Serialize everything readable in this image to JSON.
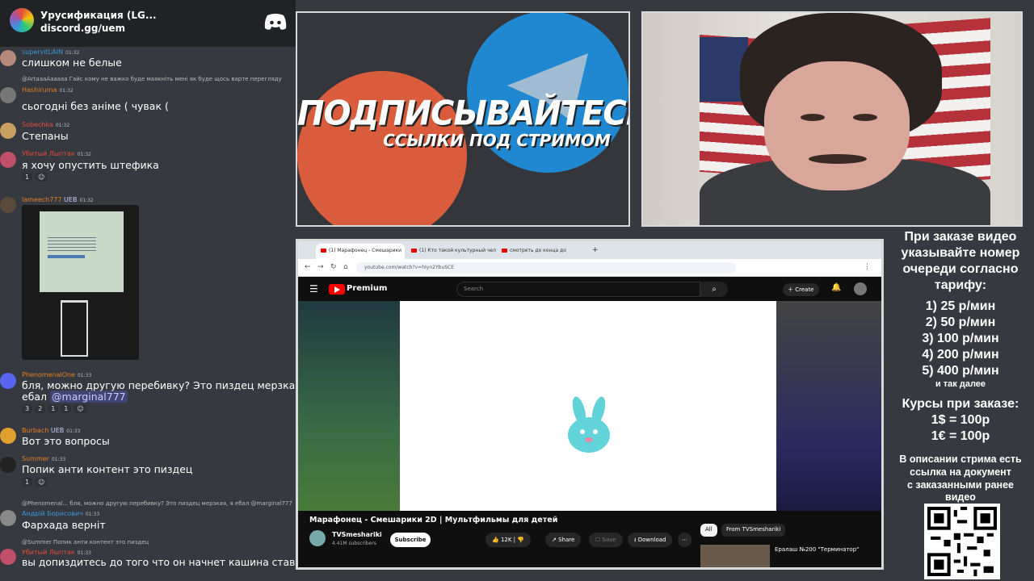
{
  "discord": {
    "server_name": "Урусификация (LG...",
    "invite": "discord.gg/uem",
    "messages": [
      {
        "user": "supervitLAIN",
        "time": "01:32",
        "text": "слишком не белые",
        "color": "#3498db"
      },
      {
        "reply": "@ArtaaaAaaaaa Гайс кому не важко буде маякніть мені як буде щось варте перегляду",
        "user": "Hashiruma",
        "time": "01:32",
        "text": "сьогодні без аніме ( чувак (",
        "color": "#e67e22"
      },
      {
        "user": "Sobechka",
        "time": "01:32",
        "text": "Степаны",
        "color": "#e74c3c"
      },
      {
        "user": "Убитый Лыптак",
        "time": "01:32",
        "text": "я хочу опустить штефика",
        "color": "#e74c3c",
        "reactions": [
          "1"
        ]
      },
      {
        "user": "lameech777",
        "badge": "UEB",
        "time": "01:32",
        "text": "",
        "color": "#e67e22"
      },
      {
        "user": "PhenomenalOne",
        "time": "01:33",
        "text": "бля, можно другую перебивку? Это пиздец мерзкая, я",
        "text2": "ебал",
        "mention": "@marginal777",
        "color": "#e67e22",
        "reactions": [
          "3",
          "2",
          "1",
          "1"
        ]
      },
      {
        "user": "Burbach",
        "badge": "UEB",
        "time": "01:33",
        "text": "Вот это вопросы",
        "color": "#e67e22"
      },
      {
        "user": "Summer",
        "time": "01:33",
        "text": "Попик анти контент это пиздец",
        "color": "#e67e22",
        "reactions": [
          "1"
        ]
      },
      {
        "reply": "@Phenomenal... бля, можно другую перебивку? Это пиздец мерзкая, я ебал @marginal777",
        "user": "Андрій Борисович",
        "time": "01:33",
        "text": "Фархада верніт",
        "color": "#3498db"
      },
      {
        "reply": "@Summer Попик анти контент это пиздец",
        "user": "Убитый Лыптак",
        "time": "01:33",
        "text": "вы допиздитесь до того что он начнет кашина ставить",
        "color": "#e74c3c"
      }
    ]
  },
  "promo": {
    "title": "ПОДПИСЫВАЙТЕСЬ",
    "subtitle": "ССЫЛКИ ПОД СТРИМОМ"
  },
  "browser": {
    "tabs": [
      "(1) Марафонец - Смешарики",
      "(1) Кто такой культурный чел",
      "смотреть до конца до"
    ],
    "url": "youtube.com/watch?v=hIyn2YbuSCE",
    "yt_brand": "Premium",
    "search_placeholder": "Search",
    "create_label": "Create",
    "bell_count": "9+",
    "video_title": "Марафонец - Смешарики 2D | Мультфильмы для детей",
    "channel": "TVSmeshariki",
    "subscribers": "4.41M subscribers",
    "subscribe": "Subscribe",
    "likes": "12K",
    "share": "Share",
    "save": "Save",
    "download": "Download",
    "chip_all": "All",
    "chip_from": "From TVSmeshariki",
    "rec_title": "Ералаш №200 \"Терминатор\""
  },
  "info": {
    "intro": [
      "При заказе видео",
      "указывайте номер",
      "очереди согласно",
      "тарифу:"
    ],
    "tariffs": [
      "1) 25 р/мин",
      "2) 50 р/мин",
      "3) 100 р/мин",
      "4) 200 р/мин",
      "5) 400 р/мин"
    ],
    "etc": "и так далее",
    "rates_title": "Курсы при заказе:",
    "rates": [
      "1$ = 100р",
      "1€ = 100р"
    ],
    "note": [
      "В описании стрима есть",
      "ссылка на документ",
      "с заказанными ранее",
      "видео"
    ]
  }
}
